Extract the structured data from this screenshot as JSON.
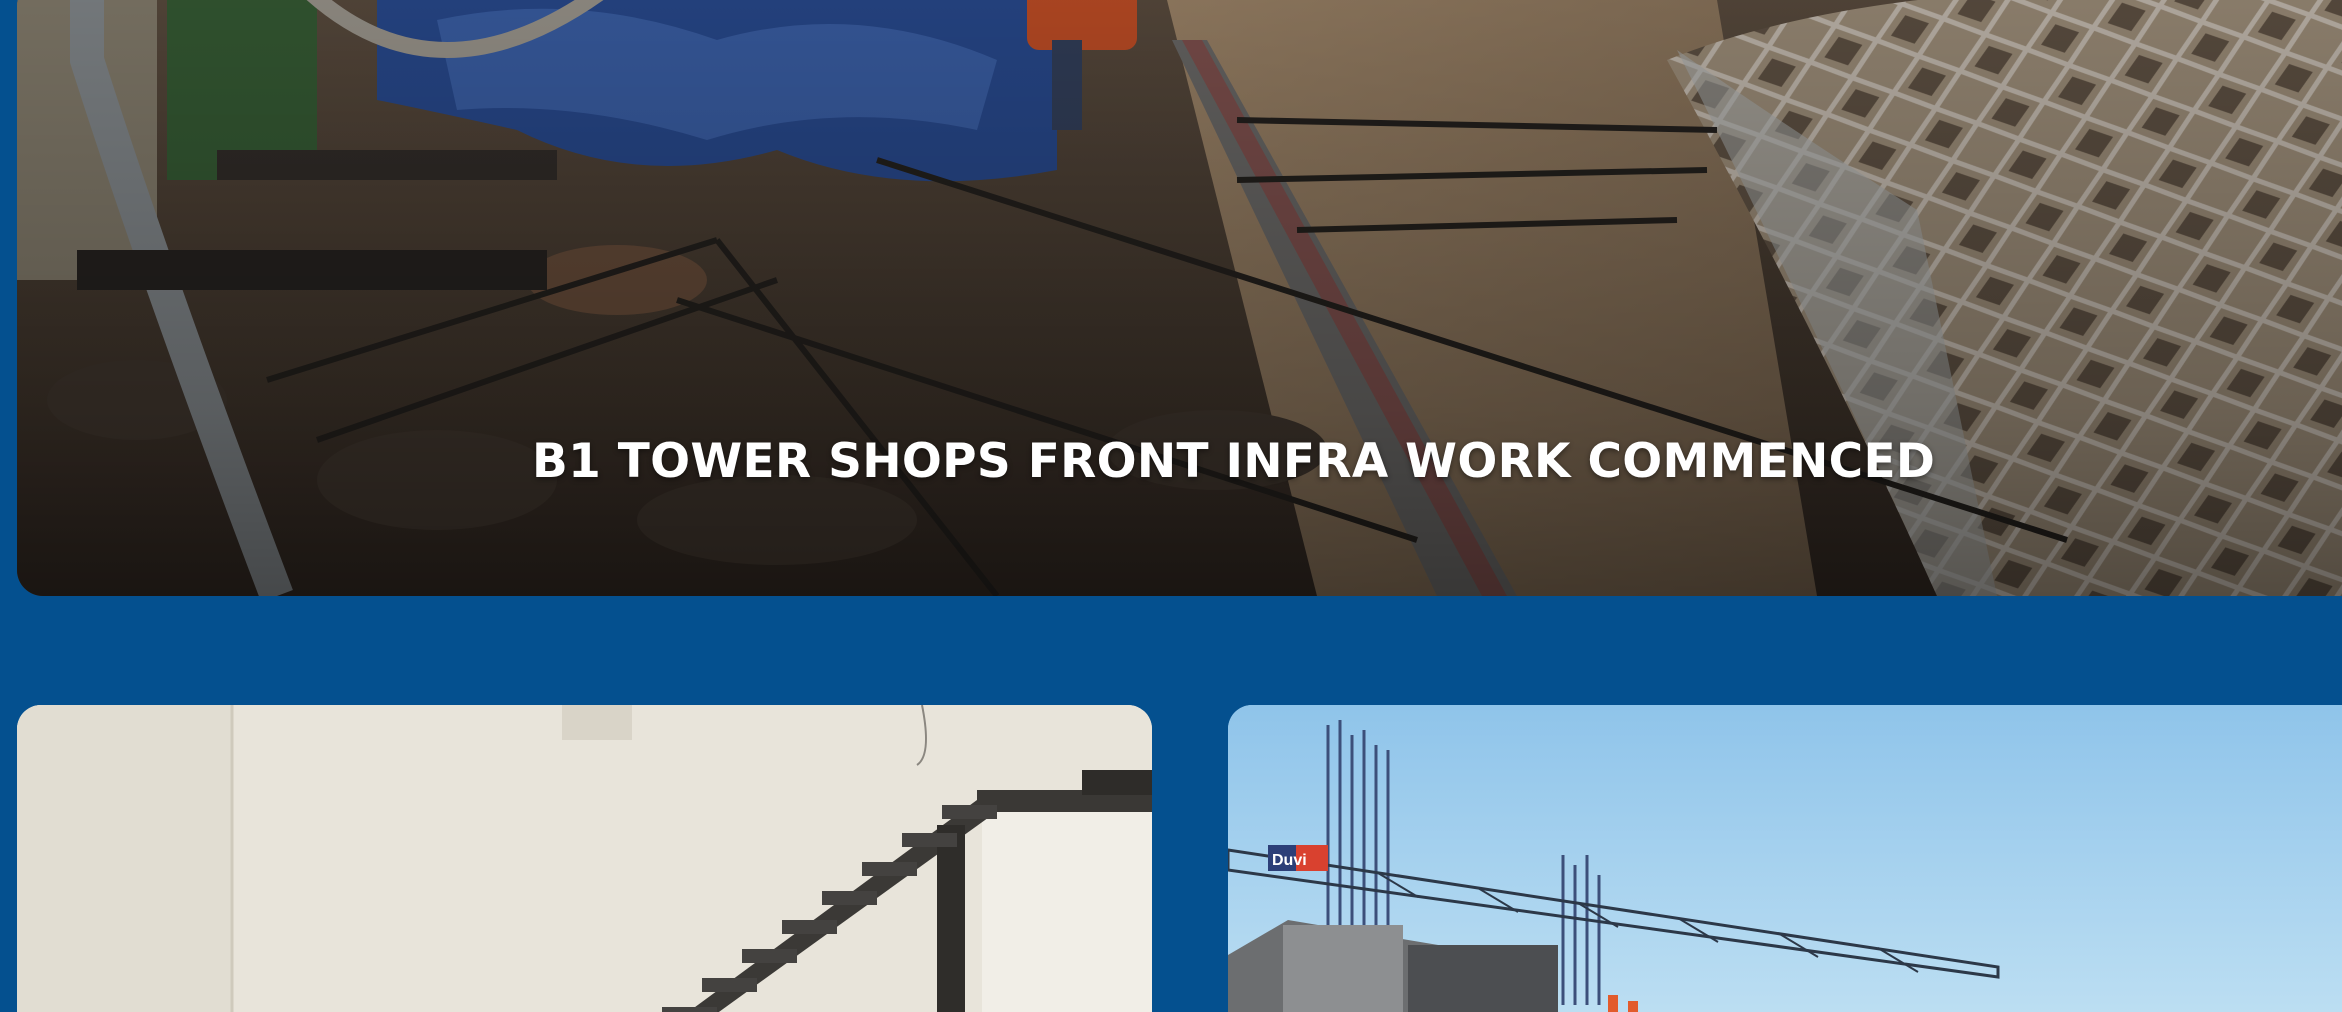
{
  "page": {
    "background_color": "#04508f"
  },
  "hero": {
    "caption": "B1 TOWER SHOPS FRONT INFRA WORK COMMENCED",
    "image_subject": "construction-site-excavation-photo"
  },
  "gallery": [
    {
      "image_subject": "interior-metal-staircase-photo"
    },
    {
      "image_subject": "tower-crane-building-construction-photo",
      "crane_sign": "Duvi"
    }
  ]
}
